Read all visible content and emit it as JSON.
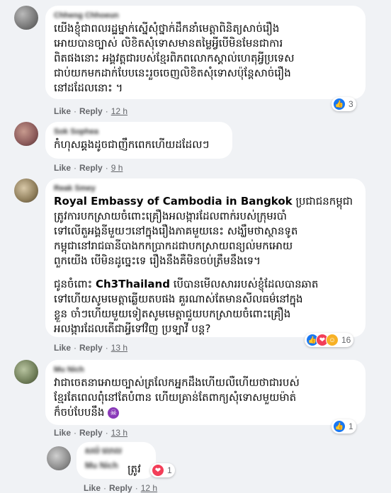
{
  "comments": [
    {
      "author": "Chheng Chhoeun",
      "text": "យើងខ្ញុំជាពលរដ្ឋម្នាក់ស្នើសុំថ្នាក់ដឹកនាំមេត្តាពិនិត្យសាច់រឿង\nអោយបានច្បាស់ លិខិតសុំទោសមានតម្លៃអ្វីបើមិនមែនជាការ\nពិតផងនោះ អង្គវត្តជារបស់ខ្មែរពិភពលោកស្គាល់ហេតុអ្វីប្រទេស\nជាប់យកមកដាក់បែបនេះរួចចេញលិខិតសុំទោសប៉ុន្តែសាច់រឿង\nនៅដដែលនោះ ។",
      "like_label": "Like",
      "reply_label": "Reply",
      "time": "12 h",
      "reactions": {
        "icons": [
          "like"
        ],
        "count": "3"
      }
    },
    {
      "author": "Sok Sophea",
      "text": "កំហុសឆ្គងដូចជាញឹកពេកហើយដដែលៗ",
      "like_label": "Like",
      "reply_label": "Reply",
      "time": "9 h"
    },
    {
      "author": "Reak Smey",
      "mention1": "Royal Embassy of Cambodia in Bangkok",
      "text1": " ប្រជាជនកម្ពុជា\nត្រូវការបកស្រាយចំពោះគ្រឿងអលង្ការដែលពាក់របស់ក្រុមរបាំ\nទៅលើតួអង្គនីមួយៗនៅក្នុងរឿងភាគមួយនេះ សង្ឃឹមថាស្ថានទូត\nកម្ពុជានៅរាជធានីបាងកកប្រាកដជាបកស្រាយពន្យល់មកអោយ\nពួកយើង បើមិនដូច្នេះទេ រឿងនឹងគឺមិនចប់ត្រឹមនឹងទេ។",
      "text2_prefix": "ជូនចំពោះ ",
      "mention2": "Ch3Thailand",
      "text2": " បើបានមើលសាររបស់ខ្ញុំដែលបានឆាត\nទៅហើយសូមមេត្តាឆ្លើយតបផង គួរណាស់តែមានសីលធម៌នៅក្នុង\nខ្លួន ចាំៗហើយមួយទៀតសូមមេត្តាជួយបកស្រាយចំពោះគ្រឿង\nអលង្ការដែលតើជាអ្វីទៅវិញ ប្រទ្បាវី បន្ត?",
      "like_label": "Like",
      "reply_label": "Reply",
      "time": "13 h",
      "reactions": {
        "icons": [
          "like",
          "love",
          "haha"
        ],
        "count": "16"
      }
    },
    {
      "author": "Mu Nich",
      "text": "វាជាចេតនាអោយច្បាស់ត្រលែកអ្នកដឹងហើយលឺហើយថាជារបស់\nខ្មែរតែពេលពុំនៅតែបំពាន ហើយគ្រាន់តែពាក្យសុំទោសមួយម៉ាត់\nក៏ចប់បែបនឹង",
      "emoji": "devil-emoji",
      "like_label": "Like",
      "reply_label": "Reply",
      "time": "13 h",
      "reactions": {
        "icons": [
          "like"
        ],
        "count": "1"
      }
    },
    {
      "author": "សល់ លោល",
      "author_line2": "Mu Nich",
      "text": "ត្រូវ",
      "like_label": "Like",
      "reply_label": "Reply",
      "time": "12 h",
      "reactions": {
        "icons": [
          "love"
        ],
        "count": "1"
      }
    }
  ],
  "colors": {
    "background": "#f0f2f5",
    "bubble": "#ffffff",
    "meta_text": "#65676b",
    "like_blue": "#1877f2",
    "love_red": "#f33e58",
    "haha_yellow": "#f7b125"
  }
}
